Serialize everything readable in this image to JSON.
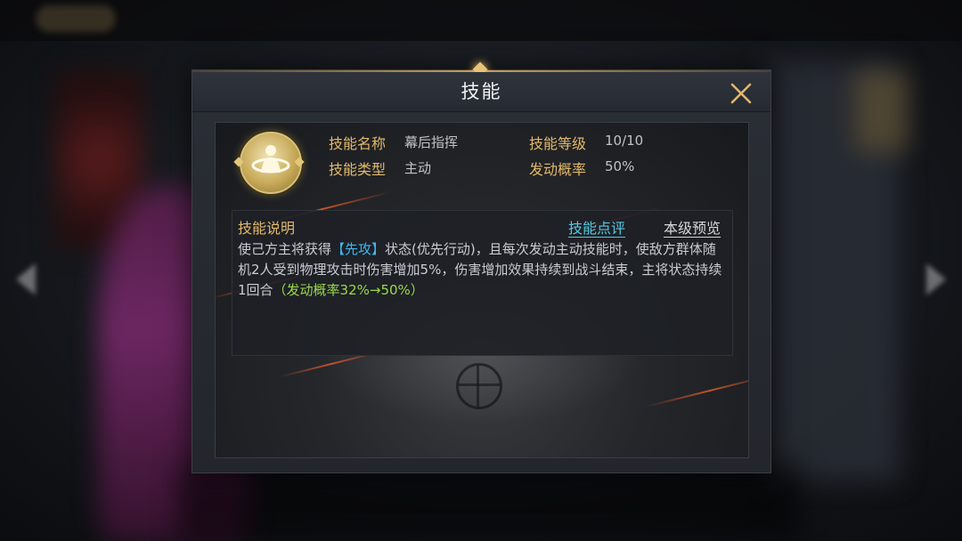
{
  "dialog": {
    "title": "技能",
    "close_icon": "close-icon"
  },
  "skill": {
    "icon": "skill-emblem-icon",
    "name_label": "技能名称",
    "name_value": "幕后指挥",
    "level_label": "技能等级",
    "level_value": "10/10",
    "type_label": "技能类型",
    "type_value": "主动",
    "chance_label": "发动概率",
    "chance_value": "50%"
  },
  "description": {
    "title": "技能说明",
    "comment_link": "技能点评",
    "preview_link": "本级预览",
    "text_part1": "使己方主将获得",
    "keyword": "【先攻】",
    "text_part2": "状态(优先行动)，且每次发动主动技能时，使敌方群体随机2人受到物理攻击时伤害增加5%，伤害增加效果持续到战斗结束，主将状态持续1回合",
    "probability_note": "（发动概率32%→50%）"
  },
  "colors": {
    "gold_label": "#e2b96b",
    "keyword_blue": "#3fb6f0",
    "link_cyan": "#58c8e0",
    "probability_green": "#9bd84a"
  }
}
